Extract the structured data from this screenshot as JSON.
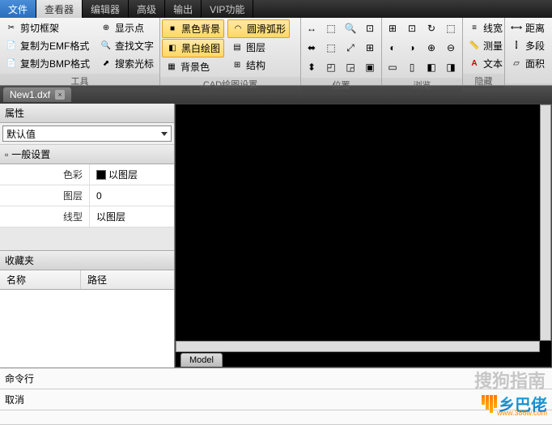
{
  "menu": {
    "file": "文件",
    "viewer": "查看器",
    "editor": "编辑器",
    "advanced": "高级",
    "output": "输出",
    "vip": "VIP功能"
  },
  "ribbon": {
    "tools": {
      "label": "工具",
      "cut_frame": "剪切框架",
      "copy_emf": "复制为EMF格式",
      "copy_bmp": "复制为BMP格式",
      "show_point": "显示点",
      "find_text": "查找文字",
      "search_cursor": "搜索光标"
    },
    "cad": {
      "label": "CAD绘图设置",
      "black_bg": "黑色背景",
      "bw_draw": "黑白绘图",
      "bg_color": "背景色",
      "smooth_arc": "圆滑弧形",
      "layer": "图层",
      "structure": "结构"
    },
    "position": {
      "label": "位置"
    },
    "browse": {
      "label": "浏览"
    },
    "hide": {
      "label": "隐藏"
    },
    "right": {
      "line_width": "线宽",
      "measure": "测量",
      "text": "文本",
      "distance": "距离",
      "multi": "多段",
      "area": "面积"
    }
  },
  "filetab": {
    "name": "New1.dxf"
  },
  "panel": {
    "props_title": "属性",
    "default": "默认值",
    "general": "一般设置",
    "color_k": "色彩",
    "color_v": "以图层",
    "layer_k": "图层",
    "layer_v": "0",
    "linetype_k": "线型",
    "linetype_v": "以图层",
    "favorites": "收藏夹",
    "col_name": "名称",
    "col_path": "路径"
  },
  "canvas": {
    "model_tab": "Model"
  },
  "cmd": {
    "line": "命令行",
    "undo": "取消"
  },
  "watermark": {
    "text": "搜狗指南"
  },
  "logo": {
    "text": "乡巴佬",
    "url": "www.386w.com"
  }
}
